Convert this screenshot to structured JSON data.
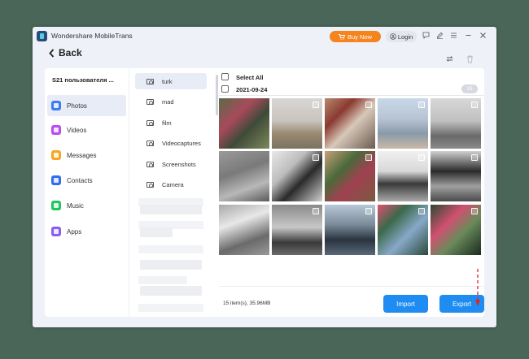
{
  "app": {
    "title": "Wondershare MobileTrans",
    "buy_now": "Buy Now",
    "login": "Login"
  },
  "header": {
    "back_label": "Back"
  },
  "device": {
    "name": "S21 пользователя ..."
  },
  "categories": [
    {
      "label": "Photos",
      "color": "#3b7cf5",
      "active": true
    },
    {
      "label": "Videos",
      "color": "#b84cf0",
      "active": false
    },
    {
      "label": "Messages",
      "color": "#f5a623",
      "active": false
    },
    {
      "label": "Contacts",
      "color": "#2f6cf2",
      "active": false
    },
    {
      "label": "Music",
      "color": "#22c55e",
      "active": false
    },
    {
      "label": "Apps",
      "color": "#8b5cf6",
      "active": false
    }
  ],
  "albums": [
    {
      "label": "turk",
      "active": true
    },
    {
      "label": "mad",
      "active": false
    },
    {
      "label": "film",
      "active": false
    },
    {
      "label": "Videocaptures",
      "active": false
    },
    {
      "label": "Screenshots",
      "active": false
    },
    {
      "label": "Camera",
      "active": false
    }
  ],
  "main": {
    "select_all": "Select All",
    "date_group": "2021-09-24",
    "group_count": "15",
    "summary": "15 item(s), 35.96MB",
    "import_label": "Import",
    "export_label": "Export"
  },
  "colors": {
    "accent": "#1e8cf0",
    "buy_now": "#f5841f",
    "arrow": "#e02424"
  },
  "icons": {
    "back": "chevron-left-icon",
    "restore": "sync-icon",
    "delete": "trash-icon",
    "feedback": "chat-icon",
    "edit": "pencil-icon",
    "menu": "menu-icon",
    "close": "close-icon",
    "minimize": "minimize-icon"
  }
}
